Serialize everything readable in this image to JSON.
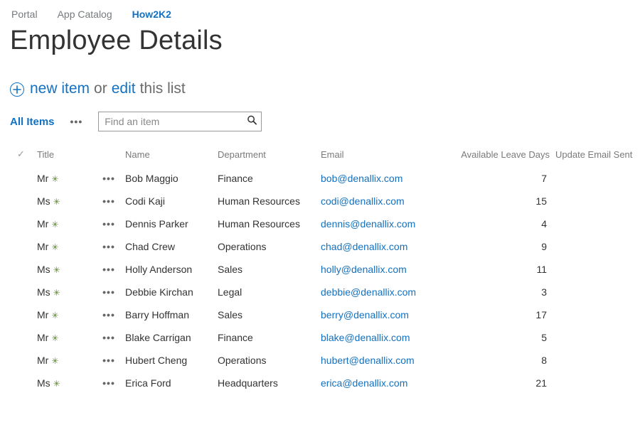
{
  "breadcrumb": {
    "items": [
      {
        "label": "Portal",
        "current": false
      },
      {
        "label": "App Catalog",
        "current": false
      },
      {
        "label": "How2K2",
        "current": true
      }
    ]
  },
  "page_title": "Employee Details",
  "actions": {
    "new_item_label": "new item",
    "or_text": "or",
    "edit_label": "edit",
    "this_list_text": "this list"
  },
  "views": {
    "current_view": "All Items",
    "search_placeholder": "Find an item"
  },
  "table": {
    "columns": {
      "title": "Title",
      "name": "Name",
      "department": "Department",
      "email": "Email",
      "available_leave_days": "Available Leave Days",
      "update_email_sent": "Update Email Sent"
    },
    "rows": [
      {
        "title": "Mr",
        "name": "Bob Maggio",
        "department": "Finance",
        "email": "bob@denallix.com",
        "leave_days": "7",
        "update_sent": ""
      },
      {
        "title": "Ms",
        "name": "Codi Kaji",
        "department": "Human Resources",
        "email": "codi@denallix.com",
        "leave_days": "15",
        "update_sent": ""
      },
      {
        "title": "Mr",
        "name": "Dennis Parker",
        "department": "Human Resources",
        "email": "dennis@denallix.com",
        "leave_days": "4",
        "update_sent": ""
      },
      {
        "title": "Mr",
        "name": "Chad Crew",
        "department": "Operations",
        "email": "chad@denallix.com",
        "leave_days": "9",
        "update_sent": ""
      },
      {
        "title": "Ms",
        "name": "Holly Anderson",
        "department": "Sales",
        "email": "holly@denallix.com",
        "leave_days": "11",
        "update_sent": ""
      },
      {
        "title": "Ms",
        "name": "Debbie Kirchan",
        "department": "Legal",
        "email": "debbie@denallix.com",
        "leave_days": "3",
        "update_sent": ""
      },
      {
        "title": "Mr",
        "name": "Barry Hoffman",
        "department": "Sales",
        "email": "berry@denallix.com",
        "leave_days": "17",
        "update_sent": ""
      },
      {
        "title": "Mr",
        "name": "Blake Carrigan",
        "department": "Finance",
        "email": "blake@denallix.com",
        "leave_days": "5",
        "update_sent": ""
      },
      {
        "title": "Mr",
        "name": "Hubert Cheng",
        "department": "Operations",
        "email": "hubert@denallix.com",
        "leave_days": "8",
        "update_sent": ""
      },
      {
        "title": "Ms",
        "name": "Erica Ford",
        "department": "Headquarters",
        "email": "erica@denallix.com",
        "leave_days": "21",
        "update_sent": ""
      }
    ]
  }
}
